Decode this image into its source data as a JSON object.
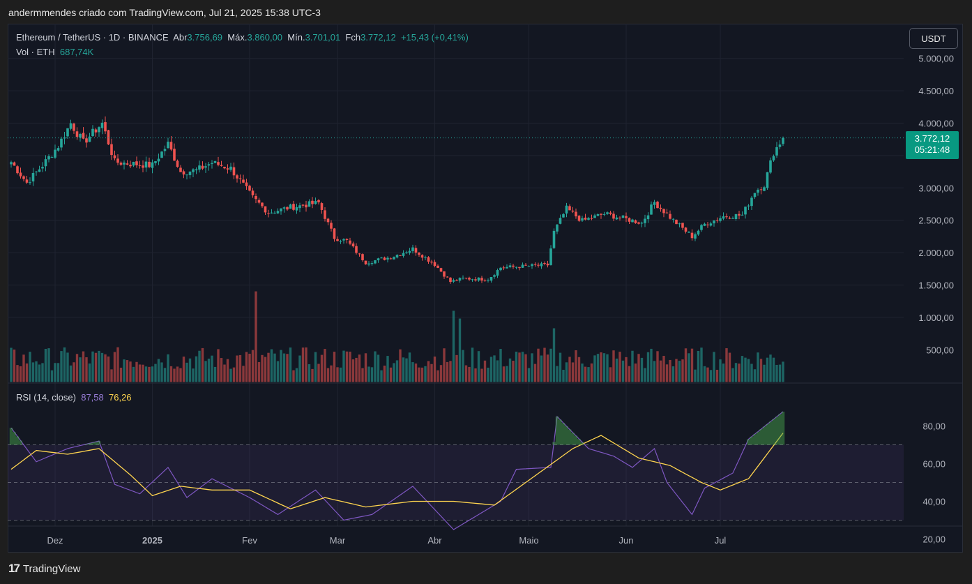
{
  "header": {
    "attribution": "andermmendes criado com TradingView.com, Jul 21, 2025 15:38 UTC-3"
  },
  "legend": {
    "symbol": "Ethereum / TetherUS · 1D · BINANCE",
    "open_label": "Abr",
    "open": "3.756,69",
    "high_label": "Máx.",
    "high": "3.860,00",
    "low_label": "Mín.",
    "low": "3.701,01",
    "close_label": "Fch",
    "close": "3.772,12",
    "change": "+15,43 (+0,41%)",
    "vol_label": "Vol · ETH",
    "vol_value": "687,74K",
    "rsi_label": "RSI (14, close)",
    "rsi_value": "87,58",
    "rsi_ma_value": "76,26"
  },
  "unit": "USDT",
  "price_tag": {
    "price": "3.772,12",
    "countdown": "05:21:48"
  },
  "brand": {
    "logo": "17",
    "name": "TradingView"
  },
  "colors": {
    "up": "#26a69a",
    "down": "#ef5350",
    "rsi": "#7e57c2",
    "rsi_ma": "#ffd54f",
    "background": "#131722"
  },
  "chart_data": [
    {
      "type": "candlestick",
      "ylim": [
        1000,
        5200
      ],
      "price_axis_ticks": [
        "5.000,00",
        "4.500,00",
        "4.000,00",
        "3.000,00",
        "2.500,00",
        "2.000,00",
        "1.500,00",
        "1.000,00",
        "500,00"
      ],
      "x_axis_ticks": [
        "Dez",
        "2025",
        "Fev",
        "Mar",
        "Abr",
        "Maio",
        "Jun",
        "Jul"
      ],
      "close_anchors": [
        {
          "date": "2024-11-17",
          "price": 3400
        },
        {
          "date": "2024-11-22",
          "price": 3080
        },
        {
          "date": "2024-11-27",
          "price": 3350
        },
        {
          "date": "2024-12-02",
          "price": 3650
        },
        {
          "date": "2024-12-06",
          "price": 4000
        },
        {
          "date": "2024-12-10",
          "price": 3700
        },
        {
          "date": "2024-12-16",
          "price": 4000
        },
        {
          "date": "2024-12-20",
          "price": 3400
        },
        {
          "date": "2024-12-26",
          "price": 3370
        },
        {
          "date": "2025-01-01",
          "price": 3350
        },
        {
          "date": "2025-01-06",
          "price": 3680
        },
        {
          "date": "2025-01-10",
          "price": 3250
        },
        {
          "date": "2025-01-15",
          "price": 3270
        },
        {
          "date": "2025-01-20",
          "price": 3390
        },
        {
          "date": "2025-01-26",
          "price": 3300
        },
        {
          "date": "2025-02-02",
          "price": 2850
        },
        {
          "date": "2025-02-07",
          "price": 2620
        },
        {
          "date": "2025-02-14",
          "price": 2700
        },
        {
          "date": "2025-02-23",
          "price": 2770
        },
        {
          "date": "2025-02-28",
          "price": 2230
        },
        {
          "date": "2025-03-04",
          "price": 2180
        },
        {
          "date": "2025-03-10",
          "price": 1850
        },
        {
          "date": "2025-03-18",
          "price": 1930
        },
        {
          "date": "2025-03-25",
          "price": 2060
        },
        {
          "date": "2025-04-01",
          "price": 1820
        },
        {
          "date": "2025-04-06",
          "price": 1550
        },
        {
          "date": "2025-04-10",
          "price": 1600
        },
        {
          "date": "2025-04-18",
          "price": 1590
        },
        {
          "date": "2025-04-22",
          "price": 1770
        },
        {
          "date": "2025-05-07",
          "price": 1810
        },
        {
          "date": "2025-05-09",
          "price": 2320
        },
        {
          "date": "2025-05-13",
          "price": 2680
        },
        {
          "date": "2025-05-18",
          "price": 2490
        },
        {
          "date": "2025-05-25",
          "price": 2600
        },
        {
          "date": "2025-06-01",
          "price": 2520
        },
        {
          "date": "2025-06-06",
          "price": 2460
        },
        {
          "date": "2025-06-10",
          "price": 2780
        },
        {
          "date": "2025-06-16",
          "price": 2500
        },
        {
          "date": "2025-06-22",
          "price": 2250
        },
        {
          "date": "2025-06-26",
          "price": 2440
        },
        {
          "date": "2025-07-02",
          "price": 2560
        },
        {
          "date": "2025-07-08",
          "price": 2580
        },
        {
          "date": "2025-07-12",
          "price": 2950
        },
        {
          "date": "2025-07-15",
          "price": 3050
        },
        {
          "date": "2025-07-18",
          "price": 3550
        },
        {
          "date": "2025-07-21",
          "price": 3772
        }
      ],
      "current_price": 3772.12
    },
    {
      "type": "bar",
      "title": "Vol · ETH",
      "note": "volume bars colored by candle direction",
      "volume_spikes": [
        {
          "date": "2025-02-03",
          "volume": 1400
        },
        {
          "date": "2025-04-07",
          "volume": 1100
        },
        {
          "date": "2025-04-09",
          "volume": 980
        },
        {
          "date": "2025-05-09",
          "volume": 830
        }
      ],
      "typical_volume": 400
    },
    {
      "type": "line",
      "title": "RSI (14, close)",
      "ylim": [
        15,
        95
      ],
      "y_ticks": [
        "80,00",
        "60,00",
        "40,00",
        "20,00"
      ],
      "bands": [
        30,
        50,
        70
      ],
      "series": [
        {
          "name": "RSI",
          "points": [
            {
              "date": "2024-11-17",
              "value": 79
            },
            {
              "date": "2024-11-25",
              "value": 61
            },
            {
              "date": "2024-12-05",
              "value": 68
            },
            {
              "date": "2024-12-15",
              "value": 72
            },
            {
              "date": "2024-12-20",
              "value": 49
            },
            {
              "date": "2024-12-28",
              "value": 44
            },
            {
              "date": "2025-01-06",
              "value": 58
            },
            {
              "date": "2025-01-12",
              "value": 42
            },
            {
              "date": "2025-01-20",
              "value": 52
            },
            {
              "date": "2025-02-01",
              "value": 42
            },
            {
              "date": "2025-02-10",
              "value": 33
            },
            {
              "date": "2025-02-22",
              "value": 46
            },
            {
              "date": "2025-03-03",
              "value": 30
            },
            {
              "date": "2025-03-12",
              "value": 33
            },
            {
              "date": "2025-03-25",
              "value": 48
            },
            {
              "date": "2025-04-07",
              "value": 25
            },
            {
              "date": "2025-04-22",
              "value": 40
            },
            {
              "date": "2025-04-27",
              "value": 57
            },
            {
              "date": "2025-05-08",
              "value": 58
            },
            {
              "date": "2025-05-10",
              "value": 85
            },
            {
              "date": "2025-05-20",
              "value": 68
            },
            {
              "date": "2025-05-28",
              "value": 64
            },
            {
              "date": "2025-06-03",
              "value": 58
            },
            {
              "date": "2025-06-10",
              "value": 68
            },
            {
              "date": "2025-06-14",
              "value": 50
            },
            {
              "date": "2025-06-22",
              "value": 33
            },
            {
              "date": "2025-06-26",
              "value": 47
            },
            {
              "date": "2025-07-05",
              "value": 55
            },
            {
              "date": "2025-07-10",
              "value": 73
            },
            {
              "date": "2025-07-21",
              "value": 87.58
            }
          ]
        },
        {
          "name": "RSI-based MA",
          "points": [
            {
              "date": "2024-11-17",
              "value": 57
            },
            {
              "date": "2024-11-25",
              "value": 67
            },
            {
              "date": "2024-12-05",
              "value": 65
            },
            {
              "date": "2024-12-15",
              "value": 68
            },
            {
              "date": "2024-12-25",
              "value": 54
            },
            {
              "date": "2025-01-01",
              "value": 43
            },
            {
              "date": "2025-01-10",
              "value": 48
            },
            {
              "date": "2025-01-20",
              "value": 46
            },
            {
              "date": "2025-02-01",
              "value": 46
            },
            {
              "date": "2025-02-14",
              "value": 36
            },
            {
              "date": "2025-02-25",
              "value": 42
            },
            {
              "date": "2025-03-10",
              "value": 37
            },
            {
              "date": "2025-03-25",
              "value": 40
            },
            {
              "date": "2025-04-07",
              "value": 40
            },
            {
              "date": "2025-04-20",
              "value": 38
            },
            {
              "date": "2025-05-05",
              "value": 56
            },
            {
              "date": "2025-05-15",
              "value": 68
            },
            {
              "date": "2025-05-24",
              "value": 75
            },
            {
              "date": "2025-06-05",
              "value": 63
            },
            {
              "date": "2025-06-15",
              "value": 59
            },
            {
              "date": "2025-06-25",
              "value": 50
            },
            {
              "date": "2025-07-01",
              "value": 46
            },
            {
              "date": "2025-07-10",
              "value": 52
            },
            {
              "date": "2025-07-21",
              "value": 76.26
            }
          ]
        }
      ]
    }
  ]
}
